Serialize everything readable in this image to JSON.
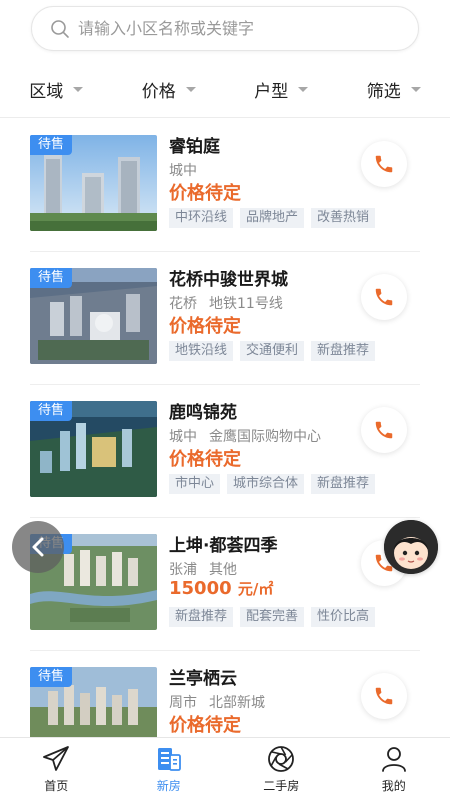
{
  "search": {
    "placeholder": "请输入小区名称或关键字",
    "value": ""
  },
  "filters": [
    {
      "label": "区域"
    },
    {
      "label": "价格"
    },
    {
      "label": "户型"
    },
    {
      "label": "筛选"
    }
  ],
  "listings": [
    {
      "badge": "待售",
      "name": "睿铂庭",
      "district": "城中",
      "landmark": "",
      "price": "价格待定",
      "unit": "",
      "tags": [
        "中环沿线",
        "品牌地产",
        "改善热销"
      ]
    },
    {
      "badge": "待售",
      "name": "花桥中骏世界城",
      "district": "花桥",
      "landmark": "地铁11号线",
      "price": "价格待定",
      "unit": "",
      "tags": [
        "地铁沿线",
        "交通便利",
        "新盘推荐"
      ]
    },
    {
      "badge": "待售",
      "name": "鹿鸣锦苑",
      "district": "城中",
      "landmark": "金鹰国际购物中心",
      "price": "价格待定",
      "unit": "",
      "tags": [
        "市中心",
        "城市综合体",
        "新盘推荐"
      ]
    },
    {
      "badge": "待售",
      "name": "上坤·都荟四季",
      "district": "张浦",
      "landmark": "其他",
      "price": "15000",
      "unit": "元/㎡",
      "tags": [
        "新盘推荐",
        "配套完善",
        "性价比高"
      ]
    },
    {
      "badge": "待售",
      "name": "兰亭栖云",
      "district": "周市",
      "landmark": "北部新城",
      "price": "价格待定",
      "unit": "",
      "tags": []
    }
  ],
  "tabbar": [
    {
      "label": "首页",
      "icon": "paper-plane-icon"
    },
    {
      "label": "新房",
      "icon": "building-icon"
    },
    {
      "label": "二手房",
      "icon": "aperture-icon"
    },
    {
      "label": "我的",
      "icon": "person-icon"
    }
  ],
  "colors": {
    "accent": "#3d8ef0",
    "price": "#ea6a2c",
    "tag_bg": "#eef1f5"
  }
}
